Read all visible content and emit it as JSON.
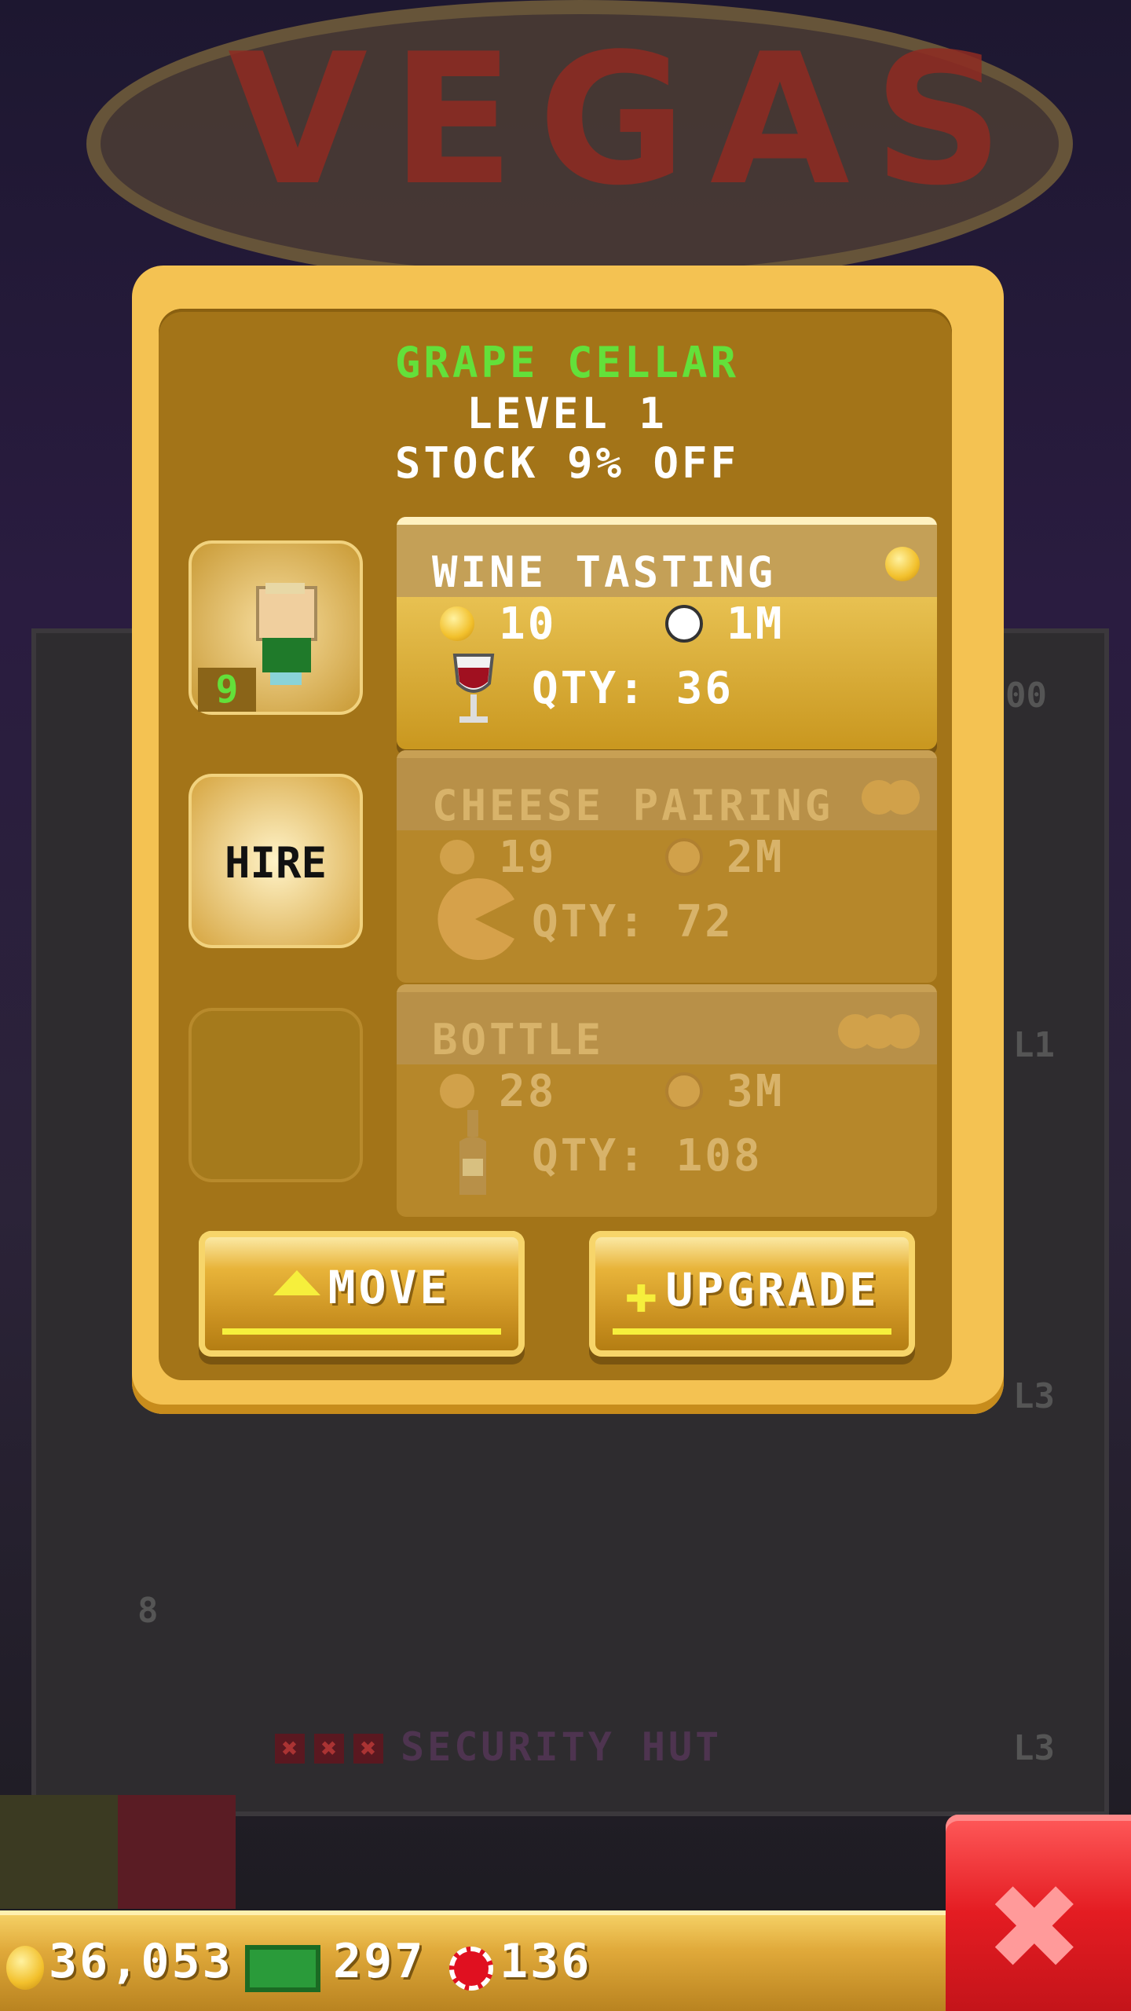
{
  "background": {
    "sign_text": "VEGAS",
    "floor_labels": [
      "00",
      "L1",
      "L3",
      "L3"
    ],
    "floor_number": "8",
    "security_hut": "SECURITY HUT"
  },
  "dialog": {
    "title": "GRAPE CELLAR",
    "level": "LEVEL 1",
    "stock": "STOCK 9% OFF",
    "worker_level": "9",
    "hire_label": "HIRE",
    "products": [
      {
        "name": "WINE TASTING",
        "cost": "10",
        "time": "1M",
        "qty": "QTY: 36",
        "icon": "wine-glass-icon",
        "active": true
      },
      {
        "name": "CHEESE PAIRING",
        "cost": "19",
        "time": "2M",
        "qty": "QTY: 72",
        "icon": "cheese-icon",
        "active": false
      },
      {
        "name": "BOTTLE",
        "cost": "28",
        "time": "3M",
        "qty": "QTY: 108",
        "icon": "wine-bottle-icon",
        "active": false
      }
    ],
    "move_label": "MOVE",
    "upgrade_label": "UPGRADE"
  },
  "bottom_bar": {
    "coins": "36,053",
    "bux": "297",
    "chips": "136"
  },
  "colors": {
    "title_green": "#63e03a",
    "gold": "#f4c252",
    "close_red": "#e41c22"
  }
}
